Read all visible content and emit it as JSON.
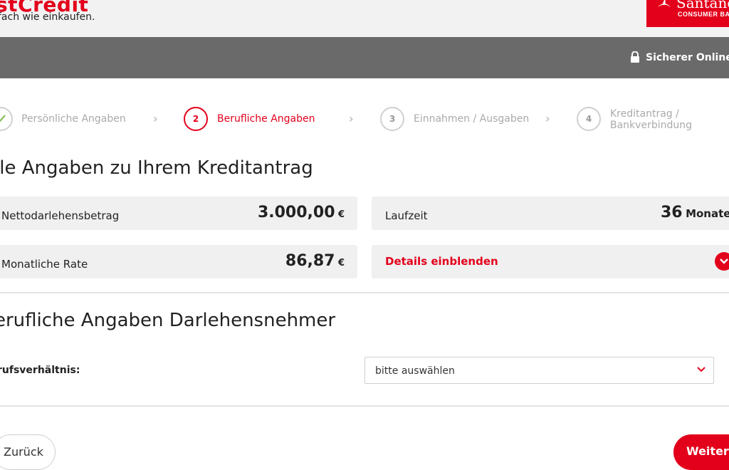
{
  "header": {
    "logo_main": "stCredit",
    "logo_tagline": "fach wie einkaufen.",
    "bank_name": "Santand",
    "bank_sub": "CONSUMER BAN"
  },
  "securebar": {
    "text": "Sicherer Online-A"
  },
  "steps": [
    {
      "label": "Persönliche Angaben",
      "state": "done",
      "icon": "check-icon"
    },
    {
      "number": "2",
      "label": "Berufliche Angaben",
      "state": "active"
    },
    {
      "number": "3",
      "label": "Einnahmen / Ausgaben",
      "state": "inactive"
    },
    {
      "number": "4",
      "label_line1": "Kreditantrag /",
      "label_line2": "Bankverbindung",
      "state": "inactive"
    }
  ],
  "summary": {
    "heading": "lle Angaben zu Ihrem Kreditantrag",
    "net_amount_label": "Nettodarlehensbetrag",
    "net_amount_value": "3.000,00",
    "net_amount_unit": "€",
    "term_label": "Laufzeit",
    "term_value": "36",
    "term_unit": "Monate",
    "rate_label": "Monatliche Rate",
    "rate_value": "86,87",
    "rate_unit": "€",
    "details_label": "Details einblenden"
  },
  "form": {
    "heading": "erufliche Angaben Darlehensnehmer",
    "employment_label": "rufsverhältnis:",
    "employment_select_value": "bitte auswählen"
  },
  "nav": {
    "back_label": "Zurück",
    "next_label": "Weiter"
  },
  "colors": {
    "brand_red": "#e3001b",
    "dark_bar": "#6a6a6a",
    "box_bg": "#f0f0f0"
  }
}
